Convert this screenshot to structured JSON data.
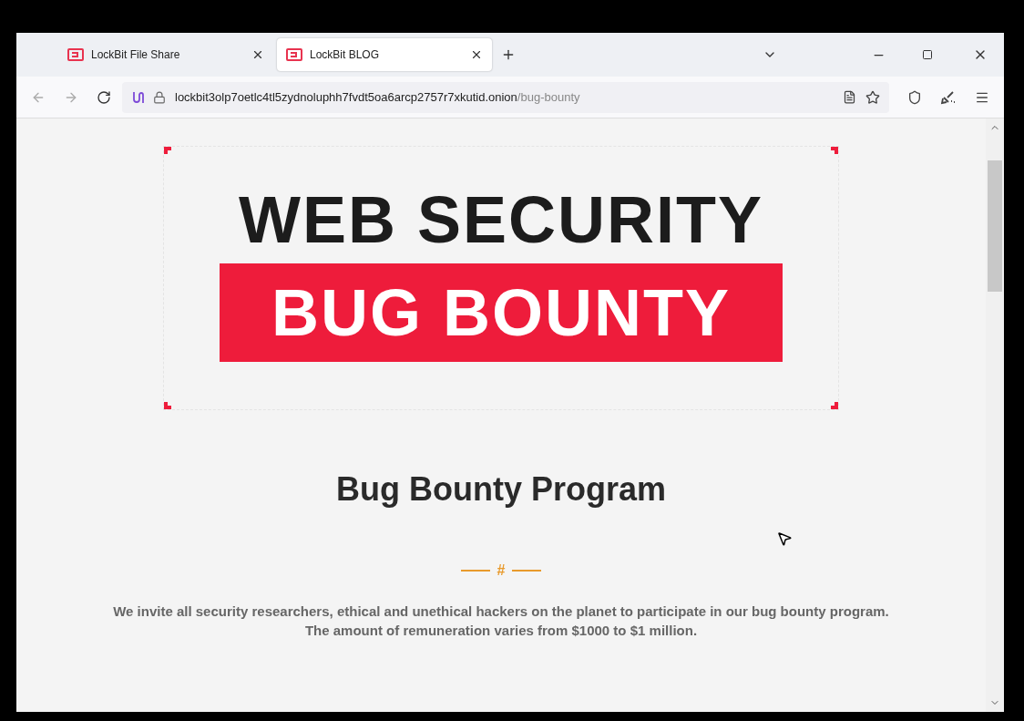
{
  "tabs": [
    {
      "label": "LockBit File Share",
      "selected": false
    },
    {
      "label": "LockBit BLOG",
      "selected": true
    }
  ],
  "address_bar": {
    "host": "lockbit3olp7oetlc4tl5zydnoluphh7fvdt5oa6arcp2757r7xkutid.onion",
    "path": "/bug-bounty"
  },
  "banner": {
    "line_1": "WEB SECURITY",
    "line_2": "BUG BOUNTY"
  },
  "heading": "Bug Bounty Program",
  "divider_mark": "#",
  "intro": [
    "We invite all security researchers, ethical and unethical hackers on the planet to participate in our bug bounty program.",
    "The amount of remuneration varies from $1000 to $1 million."
  ]
}
